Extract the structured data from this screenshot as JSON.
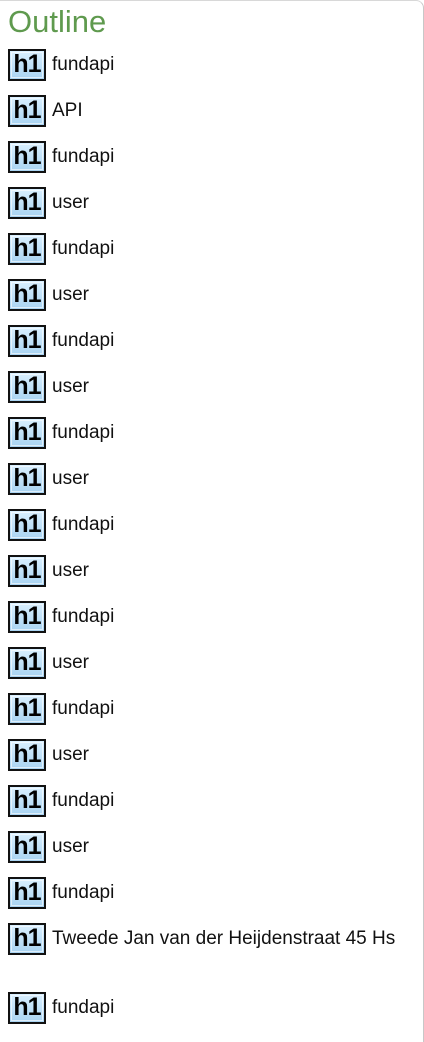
{
  "outline": {
    "title": "Outline",
    "heading_badge": "h1",
    "items": [
      {
        "label": "fundapi"
      },
      {
        "label": "API"
      },
      {
        "label": "fundapi"
      },
      {
        "label": "user"
      },
      {
        "label": "fundapi"
      },
      {
        "label": "user"
      },
      {
        "label": "fundapi"
      },
      {
        "label": "user"
      },
      {
        "label": "fundapi"
      },
      {
        "label": "user"
      },
      {
        "label": "fundapi"
      },
      {
        "label": "user"
      },
      {
        "label": "fundapi"
      },
      {
        "label": "user"
      },
      {
        "label": "fundapi"
      },
      {
        "label": "user"
      },
      {
        "label": "fundapi"
      },
      {
        "label": "user"
      },
      {
        "label": "fundapi"
      },
      {
        "label": "Tweede Jan van der Heijdenstraat 45 Hs"
      },
      {
        "label": "fundapi"
      }
    ]
  },
  "colors": {
    "title": "#5f9a4e",
    "badge_fill": "#a9d4f2",
    "text": "#111111"
  },
  "icons": {
    "heading": "h1-heading-icon"
  }
}
